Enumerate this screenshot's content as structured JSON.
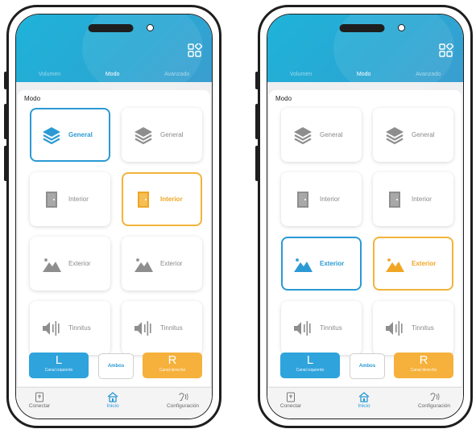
{
  "left_screen": {
    "tabs": [
      "Volumen",
      "Modo",
      "Avanzado"
    ],
    "section_title": "Modo",
    "cards": [
      {
        "label": "General",
        "icon": "layers-icon",
        "state": "selected-blue"
      },
      {
        "label": "General",
        "icon": "layers-icon",
        "state": "normal"
      },
      {
        "label": "Interior",
        "icon": "door-icon",
        "state": "normal"
      },
      {
        "label": "Interior",
        "icon": "door-icon",
        "state": "selected-orange"
      },
      {
        "label": "Exterior",
        "icon": "mountain-sun-icon",
        "state": "normal"
      },
      {
        "label": "Exterior",
        "icon": "mountain-sun-icon",
        "state": "normal"
      },
      {
        "label": "Tinnitus",
        "icon": "speaker-sound-icon",
        "state": "normal"
      },
      {
        "label": "Tinnitus",
        "icon": "speaker-sound-icon",
        "state": "normal"
      }
    ],
    "channel_left": {
      "letter": "L",
      "caption": "Canal izquierdo"
    },
    "ambos": "Ambos",
    "channel_right": {
      "letter": "R",
      "caption": "Canal derecho"
    },
    "nav": [
      "Conectar",
      "Inicio",
      "Configuración"
    ]
  },
  "right_screen": {
    "tabs": [
      "Volumen",
      "Modo",
      "Avanzado"
    ],
    "section_title": "Modo",
    "cards": [
      {
        "label": "General",
        "icon": "layers-icon",
        "state": "normal"
      },
      {
        "label": "General",
        "icon": "layers-icon",
        "state": "normal"
      },
      {
        "label": "Interior",
        "icon": "door-icon",
        "state": "normal"
      },
      {
        "label": "Interior",
        "icon": "door-icon",
        "state": "normal"
      },
      {
        "label": "Exterior",
        "icon": "mountain-sun-icon",
        "state": "selected-blue"
      },
      {
        "label": "Exterior",
        "icon": "mountain-sun-icon",
        "state": "selected-orange"
      },
      {
        "label": "Tinnitus",
        "icon": "speaker-sound-icon",
        "state": "normal"
      },
      {
        "label": "Tinnitus",
        "icon": "speaker-sound-icon",
        "state": "normal"
      }
    ],
    "channel_left": {
      "letter": "L",
      "caption": "Canal izquierdo"
    },
    "ambos": "Ambos",
    "channel_right": {
      "letter": "R",
      "caption": "Canal derecho"
    },
    "nav": [
      "Conectar",
      "Inicio",
      "Configuración"
    ]
  },
  "colors": {
    "blue": "#2b9ad4",
    "orange": "#f1b43a",
    "grey_icon": "#8e8e8e"
  }
}
